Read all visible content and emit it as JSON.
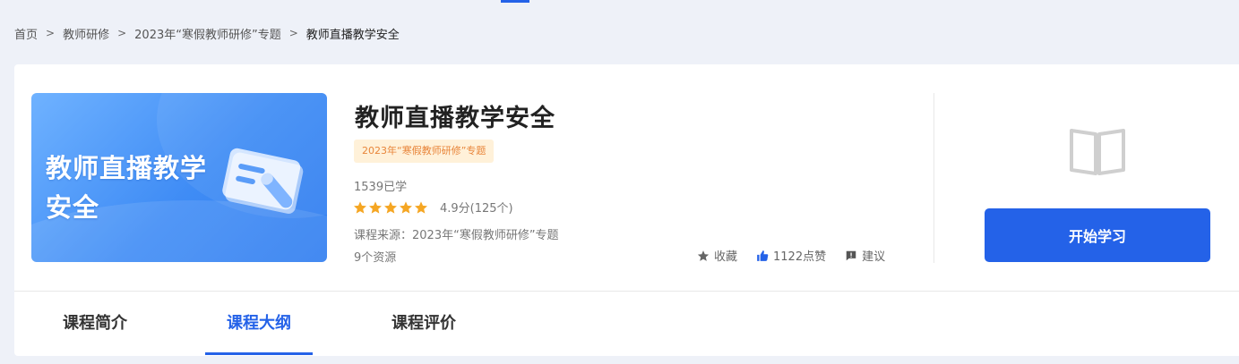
{
  "breadcrumb": {
    "items": [
      {
        "label": "首页"
      },
      {
        "label": "教师研修"
      },
      {
        "label": "2023年“寒假教师研修”专题"
      },
      {
        "label": "教师直播教学安全"
      }
    ],
    "separator": ">"
  },
  "course": {
    "cover_title": "教师直播教学安全",
    "title": "教师直播教学安全",
    "tag": "2023年“寒假教师研修”专题",
    "learners": "1539已学",
    "rating": {
      "stars": 5,
      "score_text": "4.9分(125个)",
      "star_color": "#f5a623"
    },
    "source": "课程来源：2023年“寒假教师研修”专题",
    "resources": "9个资源"
  },
  "actions": {
    "collect_label": "收藏",
    "like_label": "1122点赞",
    "suggest_label": "建议"
  },
  "side": {
    "book_icon": "open-book-icon",
    "start_button": "开始学习"
  },
  "tabs": [
    {
      "label": "课程简介",
      "active": false
    },
    {
      "label": "课程大纲",
      "active": true
    },
    {
      "label": "课程评价",
      "active": false
    }
  ],
  "colors": {
    "accent": "#2462e8",
    "tag_text": "#e8853a",
    "tag_bg": "#fff1d9",
    "page_bg": "#eef1f8"
  }
}
